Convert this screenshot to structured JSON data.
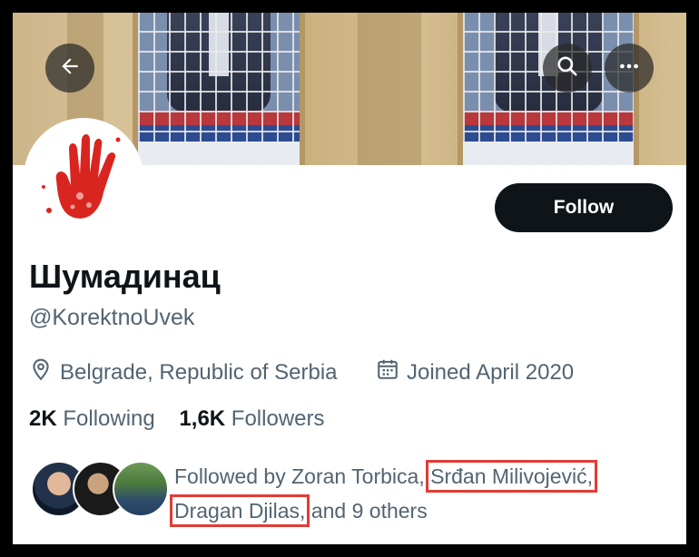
{
  "header": {
    "back_icon": "arrow-left-icon",
    "search_icon": "search-icon",
    "more_icon": "more-horizontal-icon"
  },
  "profile": {
    "name": "Шумадинац",
    "handle": "@KorektnoUvek",
    "location": "Belgrade, Republic of Serbia",
    "joined": "Joined April 2020",
    "avatar_icon": "red-hand-print-icon",
    "follow_label": "Follow"
  },
  "stats": {
    "following_count": "2K",
    "following_label": "Following",
    "followers_count": "1,6K",
    "followers_label": "Followers"
  },
  "followed_by": {
    "prefix": "Followed by Zoran Torbica,",
    "name2": "Srđan Milivojević,",
    "name3": "Dragan Djilas,",
    "suffix": "and 9 others"
  },
  "colors": {
    "highlight": "#e23b35",
    "follow_button": "#0f1419",
    "secondary_text": "#536471"
  }
}
